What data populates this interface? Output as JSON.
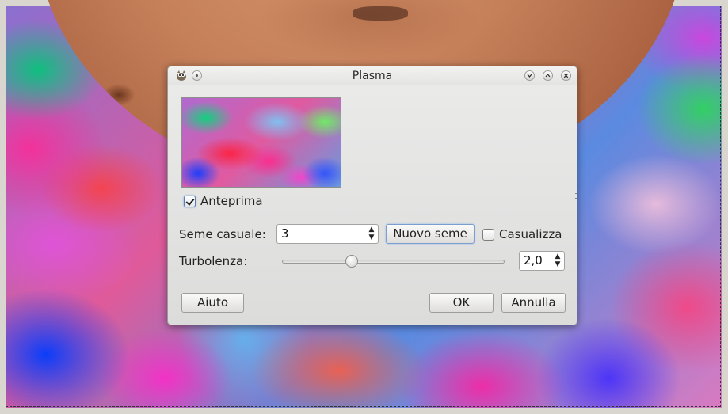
{
  "dialog": {
    "title": "Plasma",
    "buttons": {
      "help": "Aiuto",
      "ok": "OK",
      "cancel": "Annulla"
    }
  },
  "titlebar_icons": {
    "app": "gimp-icon",
    "pin": "pin-icon",
    "minimize": "chevron-down-icon",
    "maximize": "chevron-up-icon",
    "close": "close-icon"
  },
  "preview": {
    "label": "Anteprima",
    "checked": true
  },
  "seed": {
    "label": "Seme casuale:",
    "value": "3",
    "new_seed_label": "Nuovo seme",
    "randomize_label": "Casualizza",
    "randomize_checked": false
  },
  "turbulence": {
    "label": "Turbolenza:",
    "value": "2,0",
    "slider_fraction": 0.3
  },
  "colors": {
    "dialog_bg": "#e4e4e3",
    "focus_accent": "#7a9fcf"
  }
}
